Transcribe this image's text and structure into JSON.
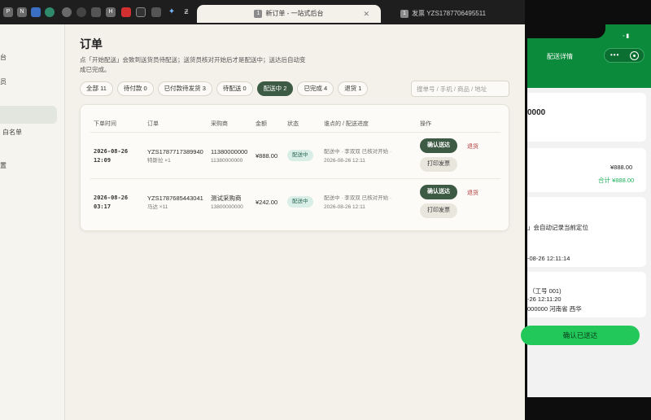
{
  "browser": {
    "extensions": [
      "P",
      "N",
      "",
      "",
      "",
      "",
      "",
      "H",
      "",
      "",
      "",
      "",
      ""
    ],
    "tabs": [
      {
        "num": "1",
        "title": "新订单 - 一站式后台",
        "active": true
      },
      {
        "num": "1",
        "title": "发票 YZS1787706495511",
        "active": false
      }
    ]
  },
  "sidebar": {
    "items": [
      "台",
      "员",
      "白名单",
      "置"
    ]
  },
  "page": {
    "title": "订单",
    "description": "点「开始配送」会致到送货员待配送；送货员核对开始后才是配送中；送达后自动变成已完成。"
  },
  "filters": [
    {
      "label": "全部 11",
      "active": false
    },
    {
      "label": "待付款 0",
      "active": false
    },
    {
      "label": "已付款待发货 3",
      "active": false
    },
    {
      "label": "待配送 0",
      "active": false
    },
    {
      "label": "配送中 2",
      "active": true
    },
    {
      "label": "已完成 4",
      "active": false
    },
    {
      "label": "退货 1",
      "active": false
    }
  ],
  "search": {
    "placeholder": "搜单号 / 手机 / 商品 / 地址"
  },
  "table": {
    "headers": [
      "下单时间",
      "订单",
      "采购商",
      "金额",
      "状态",
      "谁点的 / 配送进度",
      "操作"
    ],
    "rows": [
      {
        "date": "2026-08-26",
        "time": "12:09",
        "order_no": "YZS1787717389940",
        "order_item": "特斯拉 ×1",
        "buyer": "11380000000",
        "buyer_phone": "11380000000",
        "amount": "¥888.00",
        "status": "配送中",
        "progress_line1": "配送中 · 李双双 已核对开始 ·",
        "progress_line2": "2026-08-26 12:11",
        "confirm_label": "确认送达",
        "invoice_label": "打印发票",
        "refund_label": "退货"
      },
      {
        "date": "2026-08-26",
        "time": "03:17",
        "order_no": "YZS1787685443041",
        "order_item": "马达 ×11",
        "buyer": "测试采购商",
        "buyer_phone": "13800000000",
        "amount": "¥242.00",
        "status": "配送中",
        "progress_line1": "配送中 · 李双双 已核对开始 ·",
        "progress_line2": "2026-08-26 12:11",
        "confirm_label": "确认送达",
        "invoice_label": "打印发票",
        "refund_label": "退货"
      }
    ]
  },
  "phone": {
    "title": "配送详情",
    "amount_code": "0000",
    "price": "¥888.00",
    "total": "合计 ¥888.00",
    "auto_note": "」会自动记录当前定位",
    "time_line": "-08-26 12:11:14",
    "worker": "（工号 001)",
    "worker_time": "-26 12:11:20",
    "worker_addr": "000000 河南省 西华",
    "confirm_label": "确认已送达"
  }
}
